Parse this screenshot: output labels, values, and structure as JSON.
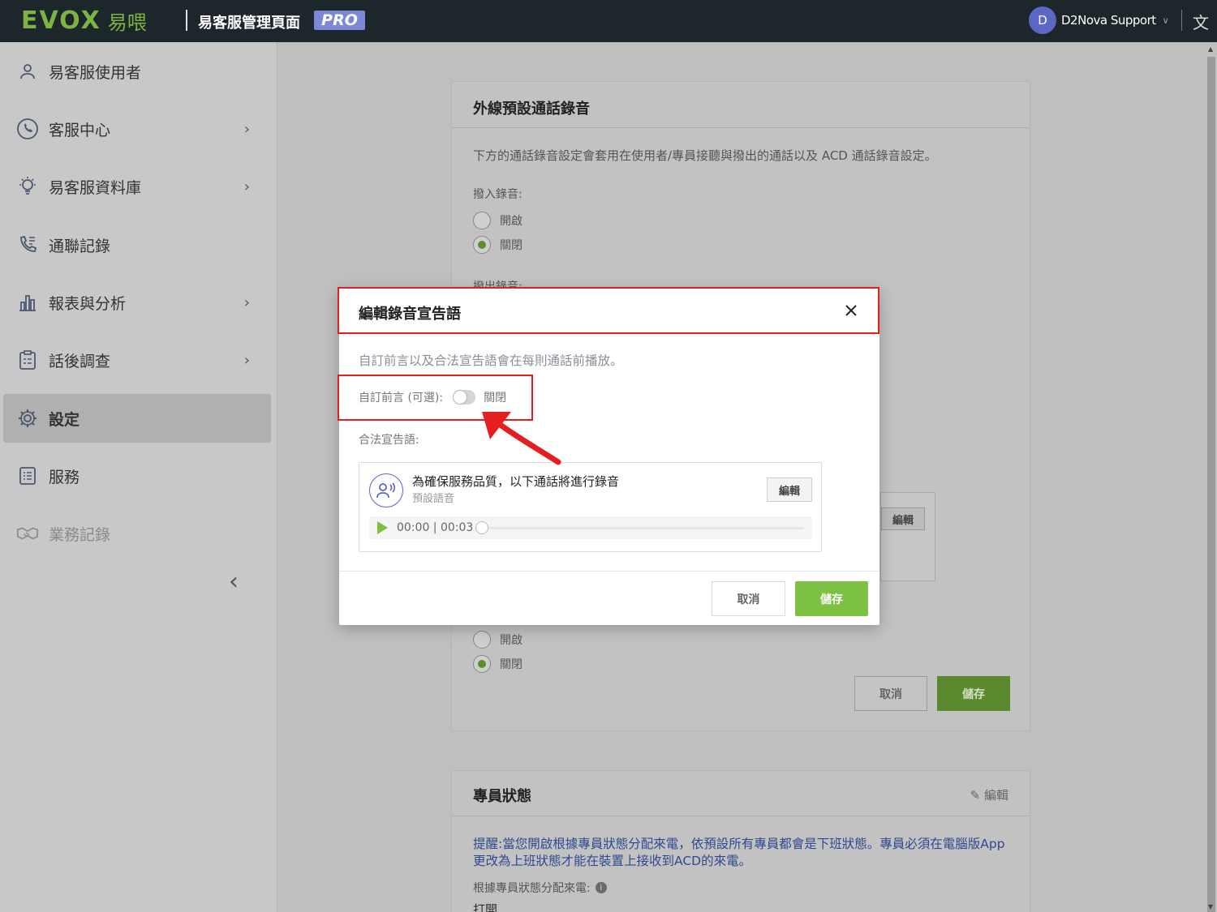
{
  "header": {
    "logo_text": "EVOX",
    "logo_cn": "易喂",
    "admin_title": "易客服管理頁面",
    "pro_badge": "PRO",
    "user": {
      "initial": "D",
      "name": "D2Nova Support"
    },
    "lang_icon": "translate-icon"
  },
  "sidebar": {
    "items": [
      {
        "label": "易客服使用者",
        "icon": "user-icon",
        "has_arrow": false
      },
      {
        "label": "客服中心",
        "icon": "phone-circle-icon",
        "has_arrow": true
      },
      {
        "label": "易客服資料庫",
        "icon": "lightbulb-icon",
        "has_arrow": true
      },
      {
        "label": "通聯記錄",
        "icon": "call-log-icon",
        "has_arrow": false
      },
      {
        "label": "報表與分析",
        "icon": "bar-chart-icon",
        "has_arrow": true
      },
      {
        "label": "話後調查",
        "icon": "survey-icon",
        "has_arrow": true
      },
      {
        "label": "設定",
        "icon": "gear-icon",
        "has_arrow": false,
        "active": true
      },
      {
        "label": "服務",
        "icon": "services-icon",
        "has_arrow": false
      },
      {
        "label": "業務記錄",
        "icon": "handshake-icon",
        "has_arrow": false,
        "disabled": true
      }
    ],
    "collapse_glyph": "‹"
  },
  "background": {
    "recording_card": {
      "title": "外線預設通話錄音",
      "description": "下方的通話錄音設定會套用在使用者/專員接聽與撥出的通話以及 ACD 通話錄音設定。",
      "inbound_label": "撥入錄音:",
      "outbound_label": "撥出錄音:",
      "option_on": "開啟",
      "option_off": "關閉",
      "inbound_selected": "off",
      "inner_edit": "編輯",
      "cancel": "取消",
      "save": "儲存"
    },
    "agent_status_card": {
      "title": "專員狀態",
      "edit": "編輯",
      "reminder": "提醒:當您開啟根據專員狀態分配來電，依預設所有專員都會是下班狀態。專員必須在電腦版App更改為上班狀態才能在裝置上接收到ACD的來電。",
      "assign_label": "根據專員狀態分配來電:",
      "assign_value": "打開"
    }
  },
  "modal": {
    "title": "編輯錄音宣告語",
    "description": "自訂前言以及合法宣告語會在每則通話前播放。",
    "custom_intro_label": "自訂前言 (可選):",
    "custom_intro_state": "關閉",
    "custom_intro_enabled": false,
    "legal_label": "合法宣告語:",
    "announcement": {
      "title": "為確保服務品質，以下通話將進行錄音",
      "subtitle": "預設語音",
      "edit_label": "編輯",
      "time": "00:00 | 00:03",
      "progress": 0
    },
    "cancel_label": "取消",
    "save_label": "儲存"
  },
  "colors": {
    "brand_green": "#7cc142",
    "annotation_red": "#e41f1f",
    "pro_purple": "#7e86d6",
    "topbar": "#1d262b"
  }
}
